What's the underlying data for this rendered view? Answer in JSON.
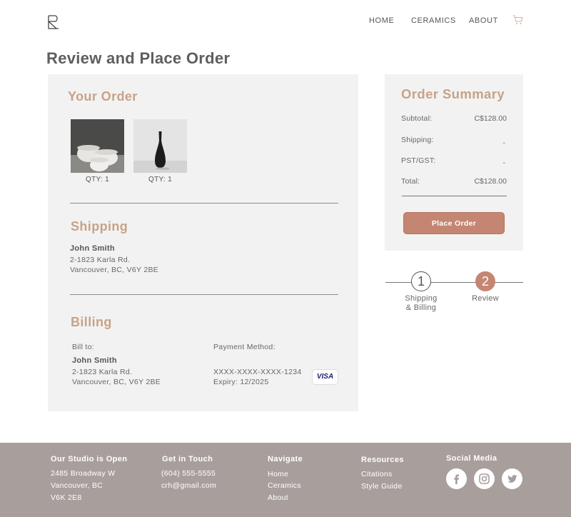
{
  "header": {
    "nav": [
      {
        "label": "HOME"
      },
      {
        "label": "CERAMICS"
      },
      {
        "label": "ABOUT"
      }
    ]
  },
  "page": {
    "title": "Review and Place Order"
  },
  "order": {
    "title": "Your Order",
    "items": [
      {
        "qty": "QTY: 1",
        "image": "white-bowls-photo"
      },
      {
        "qty": "QTY: 1",
        "image": "black-vase-photo"
      }
    ]
  },
  "shipping": {
    "title": "Shipping",
    "name": "John Smith",
    "address1": "2-1823 Karla Rd.",
    "address2": "Vancouver, BC, V6Y 2BE"
  },
  "billing": {
    "title": "Billing",
    "bill_to_label": "Bill to:",
    "name": "John Smith",
    "address1": "2-1823 Karla Rd.",
    "address2": "Vancouver, BC, V6Y 2BE",
    "payment_label": "Payment Method:",
    "card_number": "XXXX-XXXX-XXXX-1234",
    "expiry": "Expiry: 12/2025",
    "card_brand": "VISA"
  },
  "summary": {
    "title": "Order Summary",
    "rows": [
      {
        "label": "Subtotal:",
        "value": "C$128.00"
      },
      {
        "label": "Shipping:",
        "value": "-"
      },
      {
        "label": "PST/GST:",
        "value": "-"
      },
      {
        "label": "Total:",
        "value": "C$128.00"
      }
    ],
    "place_order_label": "Place Order"
  },
  "steps": [
    {
      "number": "1",
      "label_line1": "Shipping",
      "label_line2": "& Billing",
      "active": false
    },
    {
      "number": "2",
      "label_line1": "Review",
      "label_line2": "",
      "active": true
    }
  ],
  "footer": {
    "studio": {
      "heading": "Our Studio is Open",
      "lines": [
        "2485 Broadway W",
        "Vancouver, BC",
        "V6K 2E8"
      ]
    },
    "contact": {
      "heading": "Get in Touch",
      "lines": [
        "(604) 555-5555",
        "crh@gmail.com"
      ]
    },
    "navigate": {
      "heading": "Navigate",
      "links": [
        "Home",
        "Ceramics",
        "About"
      ]
    },
    "resources": {
      "heading": "Resources",
      "links": [
        "Citations",
        "Style Guide"
      ]
    },
    "social": {
      "heading": "Social Media",
      "icons": [
        "facebook-icon",
        "instagram-icon",
        "twitter-icon"
      ]
    }
  },
  "colors": {
    "accent": "#c8a287",
    "button": "#c48673",
    "panel": "#f2f2f2",
    "footer": "#a89f9d"
  }
}
